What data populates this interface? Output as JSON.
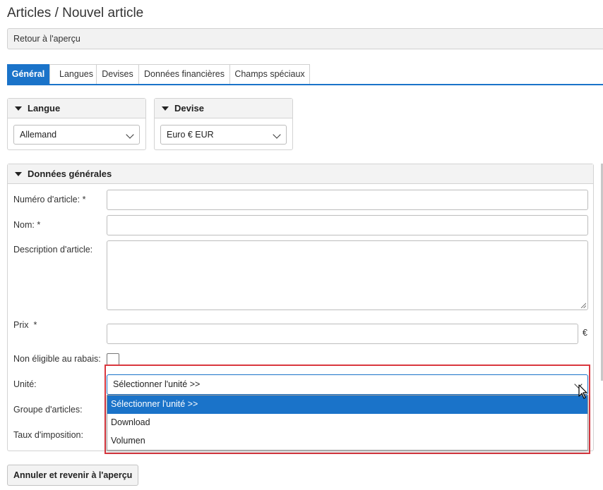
{
  "page": {
    "title": "Articles / Nouvel article"
  },
  "back_link": "Retour à l'aperçu",
  "tabs": [
    {
      "label": "Général",
      "active": true
    },
    {
      "label": "Langues"
    },
    {
      "label": "Devises"
    },
    {
      "label": "Données financières"
    },
    {
      "label": "Champs spéciaux"
    }
  ],
  "language_panel": {
    "title": "Langue",
    "value": "Allemand"
  },
  "currency_panel": {
    "title": "Devise",
    "value": "Euro € EUR"
  },
  "general_panel": {
    "title": "Données générales",
    "fields": {
      "article_number": {
        "label": "Numéro d'article:",
        "required_mark": "*",
        "value": ""
      },
      "name": {
        "label": "Nom:",
        "required_mark": "*",
        "value": ""
      },
      "description": {
        "label": "Description d'article:",
        "value": ""
      },
      "price": {
        "label": "Prix",
        "required_mark": "*",
        "value": "",
        "suffix": "€"
      },
      "no_discount": {
        "label": "Non éligible au rabais:",
        "checked": false
      },
      "unit": {
        "label": "Unité:",
        "selected": "Sélectionner l'unité >>",
        "options": [
          "Sélectionner l'unité >>",
          "Download",
          "Volumen"
        ]
      },
      "article_group": {
        "label": "Groupe d'articles:"
      },
      "tax_rate": {
        "label": "Taux d'imposition:"
      }
    }
  },
  "cancel_button": "Annuler et revenir à l'aperçu",
  "colors": {
    "accent": "#1a73c9",
    "highlight": "#d9373e"
  }
}
